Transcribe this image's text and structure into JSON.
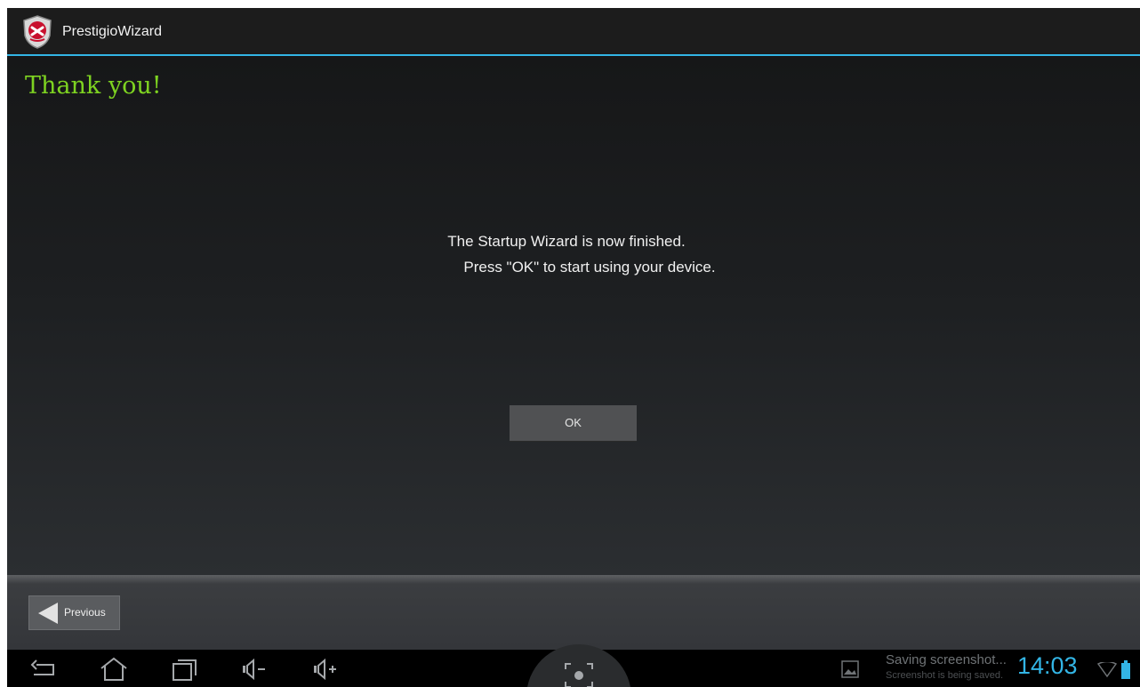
{
  "action_bar": {
    "app_title": "PrestigioWizard",
    "app_icon": "prestigio-shield-icon"
  },
  "content": {
    "heading": "Thank you!",
    "message_line1": "The Startup Wizard is now finished.",
    "message_line2": "Press \"OK\" to start using your device.",
    "ok_label": "OK"
  },
  "footer": {
    "previous_label": "Previous"
  },
  "system_bar": {
    "icons": [
      "back-icon",
      "home-icon",
      "recent-apps-icon",
      "volume-down-icon",
      "volume-up-icon",
      "screenshot-icon",
      "image-notification-icon",
      "wifi-icon",
      "battery-icon"
    ],
    "notification_title": "Saving screenshot...",
    "notification_subtitle": "Screenshot is being saved.",
    "clock": "14:03"
  },
  "colors": {
    "accent_blue": "#33b5e5",
    "heading_green": "#7ed321"
  }
}
